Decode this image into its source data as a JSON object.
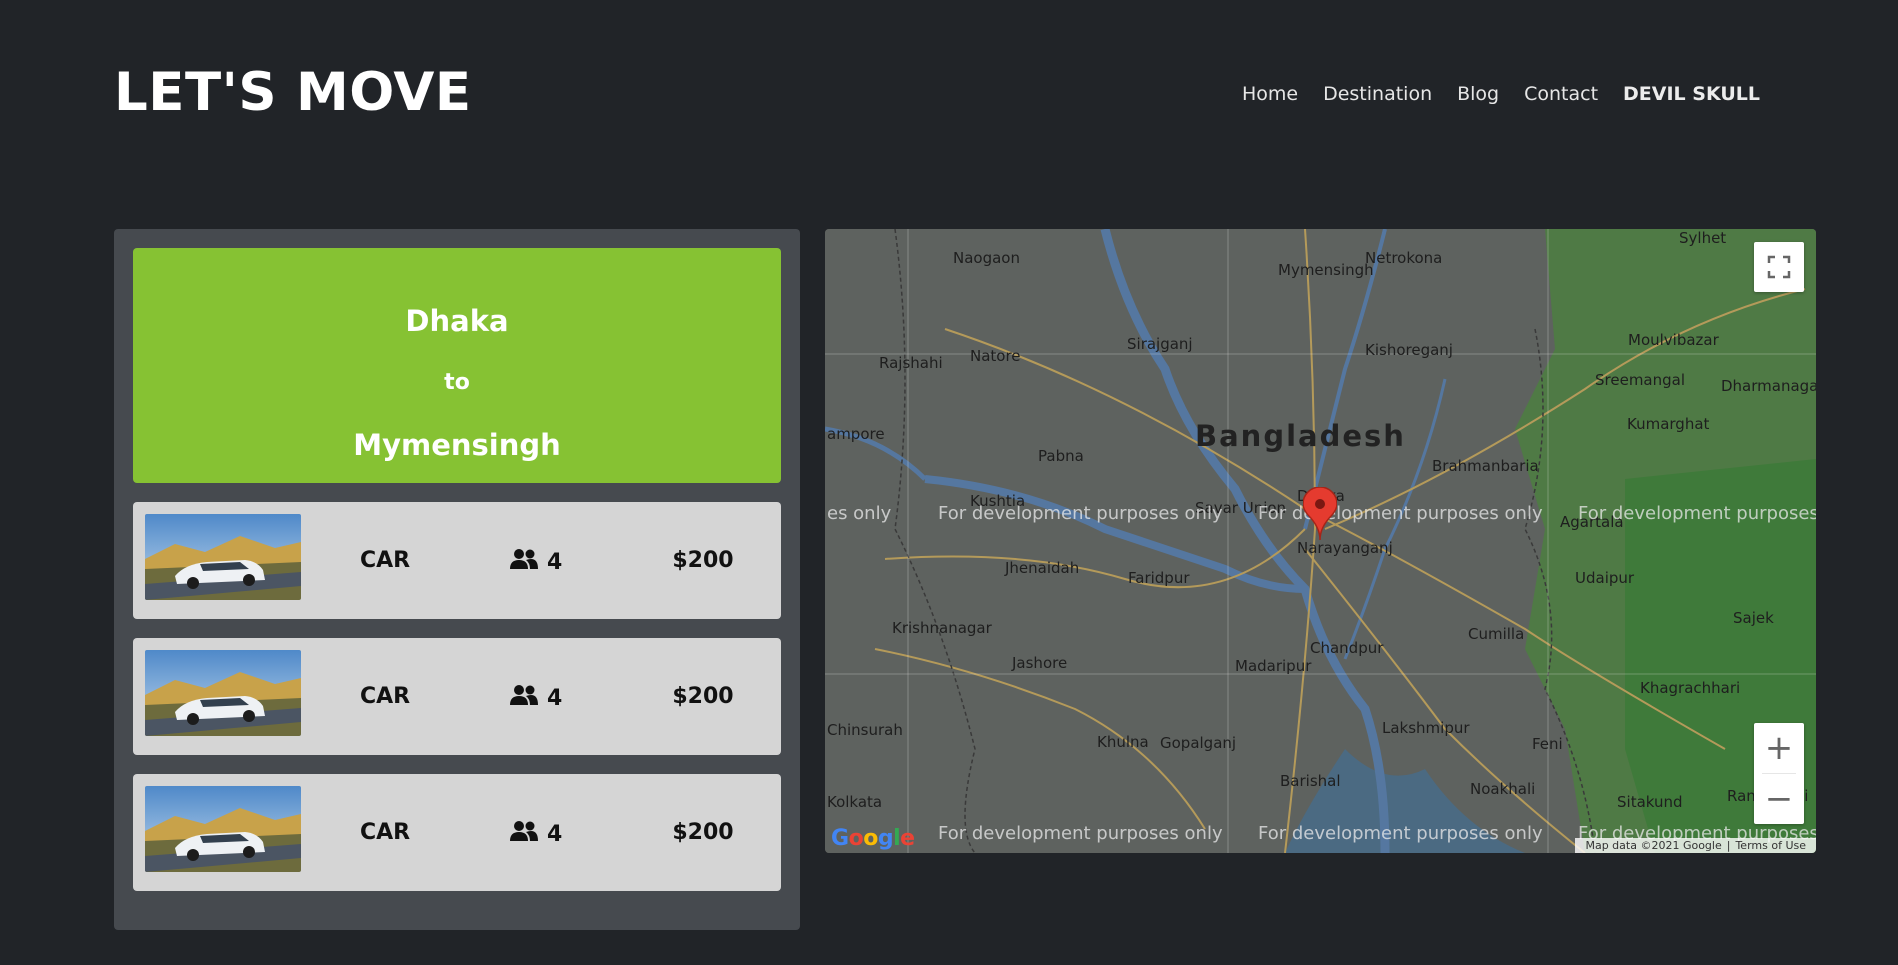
{
  "header": {
    "logo": "LET'S MOVE",
    "nav": [
      "Home",
      "Destination",
      "Blog",
      "Contact"
    ],
    "user": "DEVIL SKULL"
  },
  "route": {
    "from": "Dhaka",
    "connector": "to",
    "to": "Mymensingh"
  },
  "vehicles": [
    {
      "type": "CAR",
      "seats": "4",
      "price": "$200",
      "icon": "people-icon"
    },
    {
      "type": "CAR",
      "seats": "4",
      "price": "$200",
      "icon": "people-icon"
    },
    {
      "type": "CAR",
      "seats": "4",
      "price": "$200",
      "icon": "people-icon"
    }
  ],
  "map": {
    "country": "Bangladesh",
    "places": {
      "naogaon": "Naogaon",
      "mymensingh": "Mymensingh",
      "netrokona": "Netrokona",
      "rajshahi": "Rajshahi",
      "natore": "Natore",
      "sirajganj": "Sirajganj",
      "kishoreganj": "Kishoreganj",
      "pabna": "Pabna",
      "kushtia": "Kushtia",
      "savar": "Savar Union",
      "dhaka": "Dhaka",
      "narayanganj": "Narayanganj",
      "brahmanbaria": "Brahmanbaria",
      "agartala": "Agartala",
      "jhenaidah": "Jhenaidah",
      "faridpur": "Faridpur",
      "krishnanagar": "Krishnanagar",
      "jashore": "Jashore",
      "madaripur": "Madaripur",
      "chandpur": "Chandpur",
      "cumilla": "Cumilla",
      "chinsurah": "Chinsurah",
      "khulna": "Khulna",
      "gopalganj": "Gopalganj",
      "lakshmipur": "Lakshmipur",
      "feni": "Feni",
      "barishal": "Barishal",
      "noakhali": "Noakhali",
      "kolkata": "Kolkata",
      "sreemangal": "Sreemangal",
      "moulvibazar": "Moulvibazar",
      "sylhet": "Sylhet",
      "kumarghat": "Kumarghat",
      "dharmanagar": "Dharmanagar",
      "udaipur": "Udaipur",
      "khagrachhari": "Khagrachhari",
      "sitakund": "Sitakund",
      "rangamati": "Rangamati",
      "sajek": "Sajek",
      "ampore": "ampore"
    },
    "dev_watermark": "For development purposes only",
    "dev_watermark_left": "es only",
    "attribution": "Map data ©2021 Google",
    "terms": "Terms of Use",
    "google": "Google",
    "zoom_in": "+",
    "zoom_out": "−"
  },
  "colors": {
    "background": "#212428",
    "panel": "#464a4f",
    "accent": "#86c233",
    "row": "#d5d5d5"
  }
}
